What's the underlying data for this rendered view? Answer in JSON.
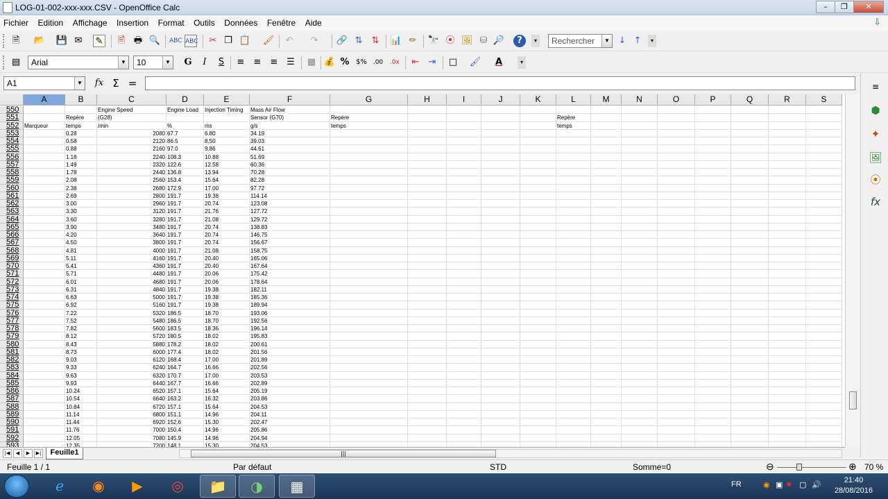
{
  "window": {
    "title": "LOG-01-002-xxx-xxx.CSV - OpenOffice Calc"
  },
  "menu": [
    "Fichier",
    "Edition",
    "Affichage",
    "Insertion",
    "Format",
    "Outils",
    "Données",
    "Fenêtre",
    "Aide"
  ],
  "toolbar": {
    "search_placeholder": "Rechercher"
  },
  "format_bar": {
    "font_name": "Arial",
    "font_size": "10"
  },
  "formula_bar": {
    "name_box": "A1",
    "content": ""
  },
  "columns": [
    "A",
    "B",
    "C",
    "D",
    "E",
    "F",
    "G",
    "H",
    "I",
    "J",
    "K",
    "L",
    "M",
    "N",
    "O",
    "P",
    "Q",
    "R",
    "S"
  ],
  "header_rows": [
    {
      "n": "550",
      "b": "",
      "c": "Engine Speed",
      "d": "Engine Load",
      "e": "Injection Timing",
      "f": "Mass Air Flow",
      "g": "",
      "l": ""
    },
    {
      "n": "551",
      "b": "Repère",
      "c": "(G28)",
      "d": "",
      "e": "",
      "f": "Sensor (G70)",
      "g": "Repère",
      "l": "Repère"
    },
    {
      "n": "552",
      "a": "Marqueur",
      "b": "temps",
      "c": "/min",
      "d": "%",
      "e": "ms",
      "f": "g/s",
      "g": "temps",
      "l": "temps"
    }
  ],
  "data_rows": [
    [
      "553",
      "0.28",
      "2080",
      "67.7",
      "6.80",
      "34.19"
    ],
    [
      "554",
      "0.58",
      "2120",
      "86.5",
      "8.50",
      "39.03"
    ],
    [
      "555",
      "0.88",
      "2160",
      "97.0",
      "9.86",
      "44.61"
    ],
    [
      "556",
      "1.18",
      "2240",
      "108.3",
      "10.88",
      "51.69"
    ],
    [
      "557",
      "1.49",
      "2320",
      "122.6",
      "12.58",
      "60.36"
    ],
    [
      "558",
      "1.78",
      "2440",
      "136.8",
      "13.94",
      "70.28"
    ],
    [
      "559",
      "2.08",
      "2560",
      "153.4",
      "15.64",
      "82.28"
    ],
    [
      "560",
      "2.38",
      "2680",
      "172.9",
      "17.00",
      "97.72"
    ],
    [
      "561",
      "2.69",
      "2800",
      "191.7",
      "19.38",
      "114.14"
    ],
    [
      "562",
      "3.00",
      "2960",
      "191.7",
      "20.74",
      "123.08"
    ],
    [
      "563",
      "3.30",
      "3120",
      "191.7",
      "21.76",
      "127.72"
    ],
    [
      "564",
      "3.60",
      "3280",
      "191.7",
      "21.08",
      "129.72"
    ],
    [
      "565",
      "3.90",
      "3480",
      "191.7",
      "20.74",
      "138.83"
    ],
    [
      "566",
      "4.20",
      "3640",
      "191.7",
      "20.74",
      "146.75"
    ],
    [
      "567",
      "4.50",
      "3800",
      "191.7",
      "20.74",
      "156.67"
    ],
    [
      "568",
      "4.81",
      "4000",
      "191.7",
      "21.08",
      "158.75"
    ],
    [
      "569",
      "5.11",
      "4160",
      "191.7",
      "20.40",
      "165.06"
    ],
    [
      "570",
      "5.41",
      "4360",
      "191.7",
      "20.40",
      "167.64"
    ],
    [
      "571",
      "5.71",
      "4480",
      "191.7",
      "20.06",
      "175.42"
    ],
    [
      "572",
      "6.01",
      "4680",
      "191.7",
      "20.06",
      "178.64"
    ],
    [
      "573",
      "6.31",
      "4840",
      "191.7",
      "19.38",
      "182.11"
    ],
    [
      "574",
      "6.63",
      "5000",
      "191.7",
      "19.38",
      "185.36"
    ],
    [
      "575",
      "6.92",
      "5160",
      "191.7",
      "19.38",
      "189.94"
    ],
    [
      "576",
      "7.22",
      "5320",
      "186.5",
      "18.70",
      "193.06"
    ],
    [
      "577",
      "7.52",
      "5480",
      "186.5",
      "18.70",
      "192.56"
    ],
    [
      "578",
      "7.82",
      "5600",
      "183.5",
      "18.36",
      "196.14"
    ],
    [
      "579",
      "8.12",
      "5720",
      "180.5",
      "18.02",
      "195.83"
    ],
    [
      "580",
      "8.43",
      "5880",
      "178.2",
      "18.02",
      "200.61"
    ],
    [
      "581",
      "8.73",
      "6000",
      "177.4",
      "18.02",
      "201.56"
    ],
    [
      "582",
      "9.03",
      "6120",
      "168.4",
      "17.00",
      "201.89"
    ],
    [
      "583",
      "9.33",
      "6240",
      "164.7",
      "16.66",
      "202.56"
    ],
    [
      "584",
      "9.63",
      "6320",
      "170.7",
      "17.00",
      "203.53"
    ],
    [
      "585",
      "9.93",
      "6440",
      "167.7",
      "16.66",
      "202.89"
    ],
    [
      "586",
      "10.24",
      "6520",
      "157.1",
      "15.64",
      "205.19"
    ],
    [
      "587",
      "10.54",
      "6640",
      "163.2",
      "16.32",
      "203.86"
    ],
    [
      "588",
      "10.84",
      "6720",
      "157.1",
      "15.64",
      "204.53"
    ],
    [
      "589",
      "11.14",
      "6800",
      "151.1",
      "14.96",
      "204.11"
    ],
    [
      "590",
      "11.44",
      "6920",
      "152.6",
      "15.30",
      "202.47"
    ],
    [
      "591",
      "11.76",
      "7000",
      "150.4",
      "14.96",
      "205.86"
    ],
    [
      "592",
      "12.05",
      "7080",
      "145.9",
      "14.96",
      "204.94"
    ],
    [
      "593",
      "12.35",
      "7200",
      "148.1",
      "15.30",
      "204.53"
    ]
  ],
  "sheet_tab": "Feuille1",
  "status": {
    "sheet": "Feuille 1 / 1",
    "style": "Par défaut",
    "mode": "STD",
    "sum": "Somme=0",
    "zoom": "70 %"
  },
  "taskbar": {
    "lang": "FR",
    "time": "21:40",
    "date": "28/08/2016"
  },
  "colors": {
    "selected_col": "#7fa7dc",
    "taskbar": "#1b3557"
  }
}
